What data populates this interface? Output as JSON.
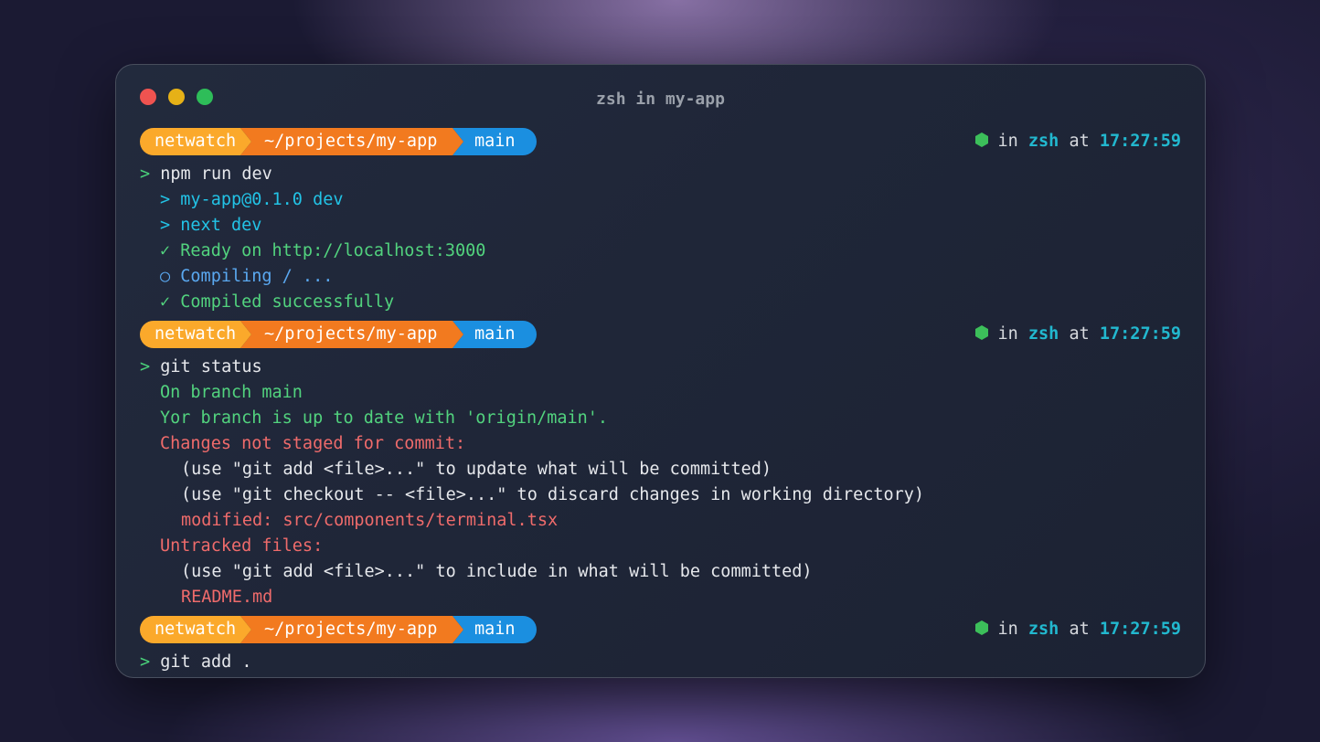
{
  "window": {
    "title": "zsh in my-app",
    "colors": {
      "close": "#ef5350",
      "minimize": "#e6b117",
      "maximize": "#2ebd59"
    }
  },
  "prompt": {
    "segment_user": "netwatch",
    "segment_path": "~/projects/my-app",
    "segment_branch": "main",
    "in_word": "in",
    "shell": "zsh",
    "at_word": "at",
    "time": "17:27:59",
    "caret": ">",
    "icon": "node-hexagon-icon",
    "colors": {
      "user": "#fba92b",
      "path": "#f27a1f",
      "branch": "#1b8fe0"
    }
  },
  "blocks": [
    {
      "command": "npm run dev",
      "output": [
        {
          "text": "> my-app@0.1.0 dev",
          "style": "c-cyan",
          "indent": 1
        },
        {
          "text": "> next dev",
          "style": "c-cyan",
          "indent": 1
        },
        {
          "text": "✓ Ready on http://localhost:3000",
          "style": "c-green",
          "indent": 1
        },
        {
          "text": "○ Compiling / ...",
          "style": "c-blue",
          "indent": 1
        },
        {
          "text": "✓ Compiled successfully",
          "style": "c-green",
          "indent": 1
        }
      ]
    },
    {
      "command": "git status",
      "output": [
        {
          "text": "On branch main",
          "style": "c-green",
          "indent": 1
        },
        {
          "text": "Yor branch is up to date with 'origin/main'.",
          "style": "c-green",
          "indent": 1
        },
        {
          "text": "Changes not staged for commit:",
          "style": "c-red",
          "indent": 1
        },
        {
          "text": "(use \"git add <file>...\" to update what will be committed)",
          "style": "c-white",
          "indent": 2
        },
        {
          "text": "(use \"git checkout -- <file>...\" to discard changes in working directory)",
          "style": "c-white",
          "indent": 2
        },
        {
          "text": "modified: src/components/terminal.tsx",
          "style": "c-red",
          "indent": 2
        },
        {
          "text": "Untracked files:",
          "style": "c-red",
          "indent": 1
        },
        {
          "text": "(use \"git add <file>...\" to include in what will be committed)",
          "style": "c-white",
          "indent": 2
        },
        {
          "text": "README.md",
          "style": "c-red",
          "indent": 2
        }
      ]
    },
    {
      "command": "git add .",
      "output": []
    }
  ]
}
